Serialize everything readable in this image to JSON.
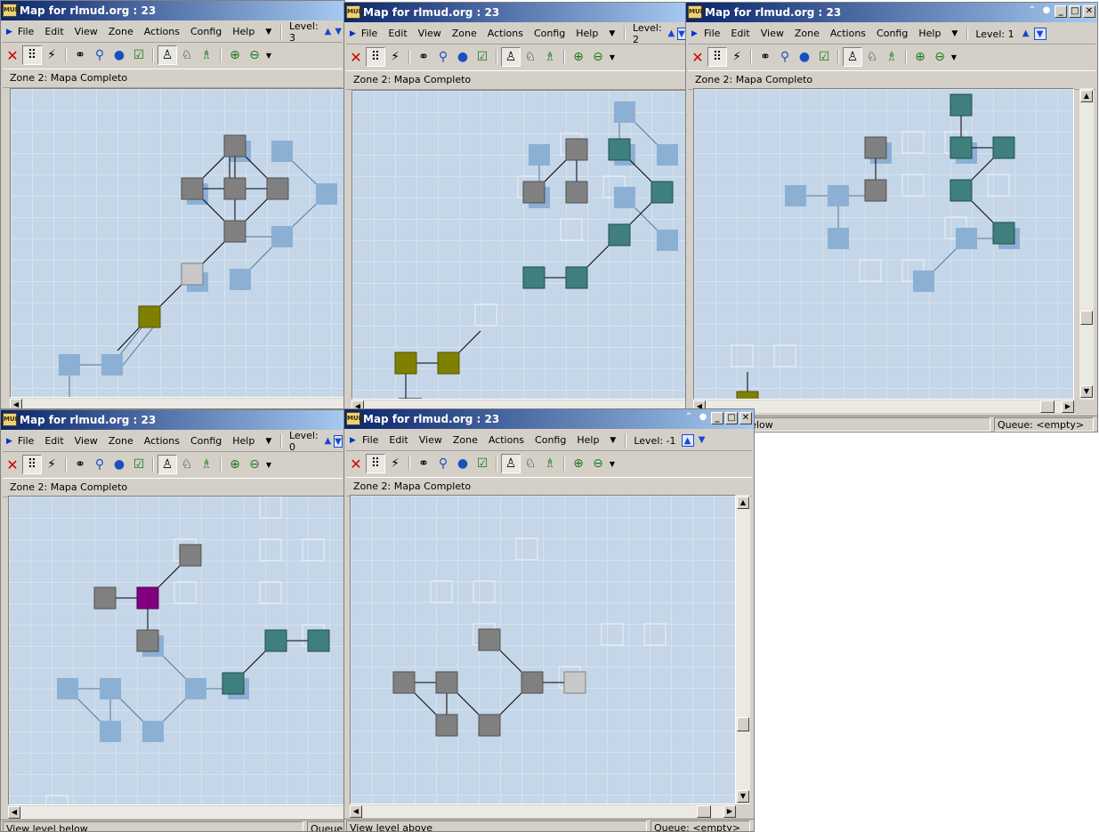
{
  "common": {
    "title": "Map for rlmud.org : 23",
    "app_icon_label": "MUD",
    "menu": [
      "File",
      "Edit",
      "View",
      "Zone",
      "Actions",
      "Config",
      "Help"
    ],
    "zone_label": "Zone 2: Mapa Completo"
  },
  "colors": {
    "canvas_bg": "#c4d6e8",
    "room_gray": "#808080",
    "room_light": "#c8c8c8",
    "room_teal": "#3f7f7d",
    "room_olive": "#808000",
    "room_purple": "#800080",
    "room_faded": "#8cb0d4"
  },
  "windows": [
    {
      "id": "w3",
      "level": "Level: 3"
    },
    {
      "id": "w2",
      "level": "Level: 2"
    },
    {
      "id": "w1",
      "level": "Level: 1",
      "status_left": "View level below",
      "status_right": "Queue: <empty>"
    },
    {
      "id": "w0",
      "level": "Level: 0",
      "status_left": "View level below",
      "status_right": "Queue: <empty>"
    },
    {
      "id": "wm1",
      "level": "Level: -1",
      "status_left": "View level above",
      "status_right": "Queue: <empty>"
    }
  ]
}
